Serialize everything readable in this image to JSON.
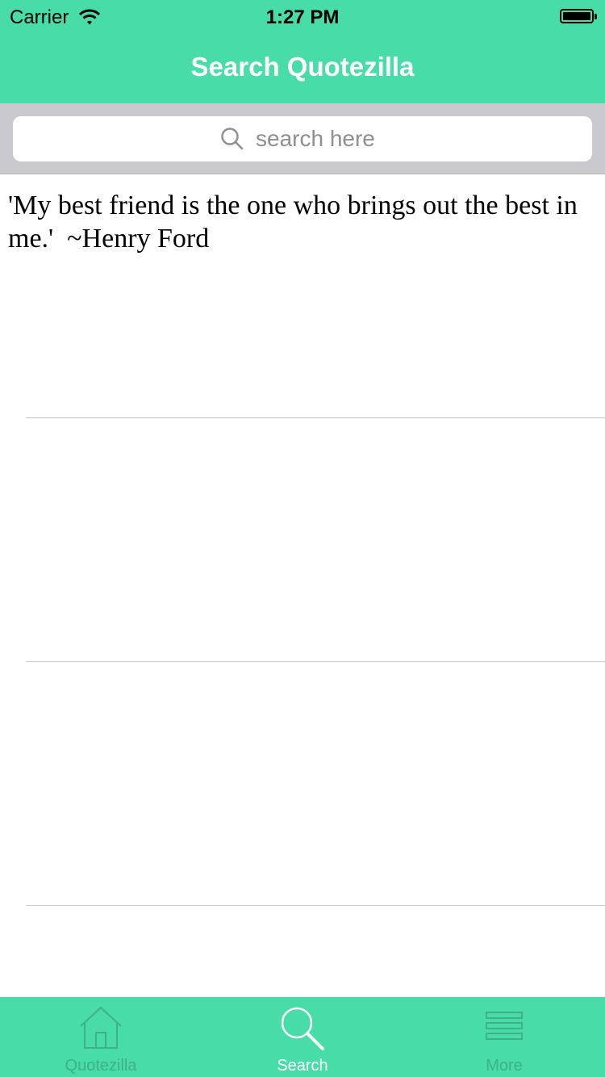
{
  "status_bar": {
    "carrier": "Carrier",
    "time": "1:27 PM",
    "wifi_icon": "wifi-icon",
    "battery_icon": "battery-icon"
  },
  "nav": {
    "title": "Search Quotezilla"
  },
  "search": {
    "placeholder": "search here",
    "value": "",
    "icon": "search-icon"
  },
  "results": [
    {
      "text": "'My best friend is the one who brings out the best in\nme.'  ~Henry Ford"
    },
    {
      "text": ""
    },
    {
      "text": ""
    }
  ],
  "tabs": [
    {
      "label": "Quotezilla",
      "icon": "home-icon",
      "active": false
    },
    {
      "label": "Search",
      "icon": "search-icon",
      "active": true
    },
    {
      "label": "More",
      "icon": "more-icon",
      "active": false
    }
  ],
  "colors": {
    "accent": "#48dca8",
    "tab_inactive": "#3fb089",
    "tab_active": "#ffffff",
    "search_background": "#c9c9ce"
  }
}
